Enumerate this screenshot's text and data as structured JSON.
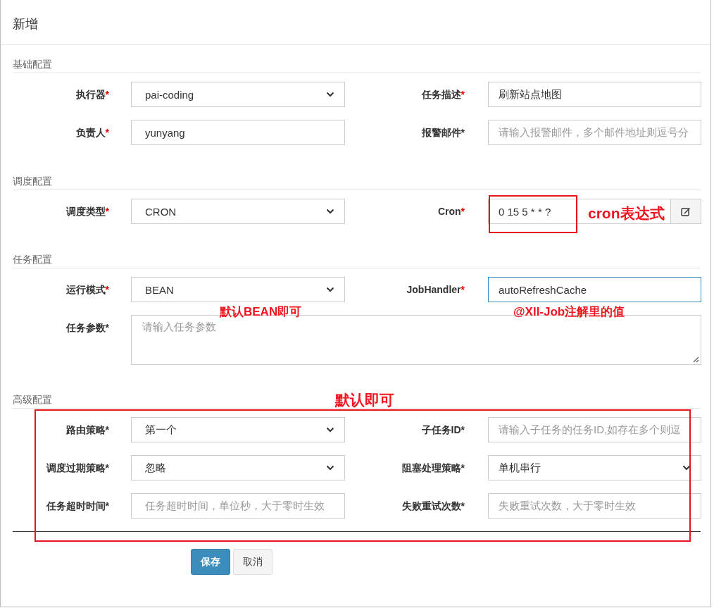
{
  "dialog": {
    "title": "新增"
  },
  "sections": [
    {
      "legend": "基础配置",
      "rows": [
        [
          {
            "label": "执行器",
            "mark": "*",
            "mark_red": true,
            "kind": "select",
            "value": "pai-coding"
          },
          {
            "label": "任务描述",
            "mark": "*",
            "mark_red": true,
            "kind": "input",
            "value": "刷新站点地图"
          }
        ],
        [
          {
            "label": "负责人",
            "mark": "*",
            "mark_red": true,
            "kind": "input",
            "value": "yunyang"
          },
          {
            "label": "报警邮件",
            "mark": "*",
            "mark_red": false,
            "kind": "input",
            "placeholder": "请输入报警邮件，多个邮件地址则逗号分"
          }
        ]
      ]
    },
    {
      "legend": "调度配置",
      "rows": [
        [
          {
            "label": "调度类型",
            "mark": "*",
            "mark_red": true,
            "kind": "select",
            "value": "CRON"
          },
          {
            "label": "Cron",
            "mark": "*",
            "mark_red": true,
            "kind": "input_button",
            "value": "0 15 5 * * ?"
          }
        ]
      ]
    },
    {
      "legend": "任务配置",
      "rows": [
        [
          {
            "label": "运行模式",
            "mark": "*",
            "mark_red": true,
            "kind": "select",
            "value": "BEAN"
          },
          {
            "label": "JobHandler",
            "mark": "*",
            "mark_red": true,
            "kind": "input",
            "value": "autoRefreshCache",
            "focused": true
          }
        ],
        [
          {
            "label": "任务参数",
            "mark": "*",
            "mark_red": false,
            "kind": "textarea",
            "placeholder": "请输入任务参数"
          }
        ]
      ]
    },
    {
      "legend": "高级配置",
      "rows": [
        [
          {
            "label": "路由策略",
            "mark": "*",
            "mark_red": false,
            "kind": "select",
            "value": "第一个"
          },
          {
            "label": "子任务ID",
            "mark": "*",
            "mark_red": false,
            "kind": "input",
            "placeholder": "请输入子任务的任务ID,如存在多个则逗"
          }
        ],
        [
          {
            "label": "调度过期策略",
            "mark": "*",
            "mark_red": false,
            "kind": "select",
            "value": "忽略"
          },
          {
            "label": "阻塞处理策略",
            "mark": "*",
            "mark_red": false,
            "kind": "select",
            "value": "单机串行"
          }
        ],
        [
          {
            "label": "任务超时时间",
            "mark": "*",
            "mark_red": false,
            "kind": "input",
            "placeholder": "任务超时时间，单位秒，大于零时生效"
          },
          {
            "label": "失败重试次数",
            "mark": "*",
            "mark_red": false,
            "kind": "input",
            "placeholder": "失败重试次数，大于零时生效"
          }
        ]
      ]
    }
  ],
  "buttons": [
    {
      "label": "保存",
      "kind": "primary"
    },
    {
      "label": "取消",
      "kind": "default"
    }
  ],
  "annotations": [
    {
      "text": "cron表达式"
    },
    {
      "text": "默认BEAN即可"
    },
    {
      "text": "@Xll-Job注解里的值"
    },
    {
      "text": "默认即可"
    }
  ]
}
